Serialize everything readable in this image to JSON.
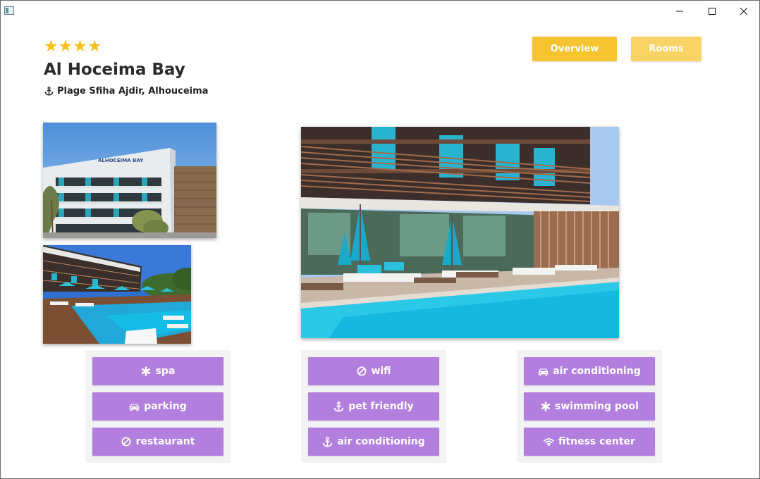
{
  "window": {
    "controls": [
      "minimize",
      "maximize",
      "close"
    ]
  },
  "hotel": {
    "stars": "★★★★",
    "star_rating": 4,
    "name": "Al Hoceima Bay",
    "address": "Plage Sfiha Ajdir, Alhouceima",
    "address_icon": "anchor-icon",
    "star_color": "#f6be1a"
  },
  "nav": {
    "overview_label": "Overview",
    "rooms_label": "Rooms",
    "overview_color": "#f6c430",
    "rooms_color": "#f8d465"
  },
  "photos": {
    "sign_text": "ALHOCEIMA BAY"
  },
  "amenities": {
    "button_color": "#b27fde",
    "groups": [
      [
        {
          "label": "spa",
          "icon": "asterisk-icon"
        },
        {
          "label": "parking",
          "icon": "car-icon"
        },
        {
          "label": "restaurant",
          "icon": "ban-icon"
        }
      ],
      [
        {
          "label": "wifi",
          "icon": "ban-icon"
        },
        {
          "label": "pet friendly",
          "icon": "anchor-icon"
        },
        {
          "label": "air conditioning",
          "icon": "anchor-icon"
        }
      ],
      [
        {
          "label": "air conditioning",
          "icon": "car-icon"
        },
        {
          "label": "swimming pool",
          "icon": "asterisk-icon"
        },
        {
          "label": "fitness center",
          "icon": "wifi-icon"
        }
      ]
    ]
  }
}
